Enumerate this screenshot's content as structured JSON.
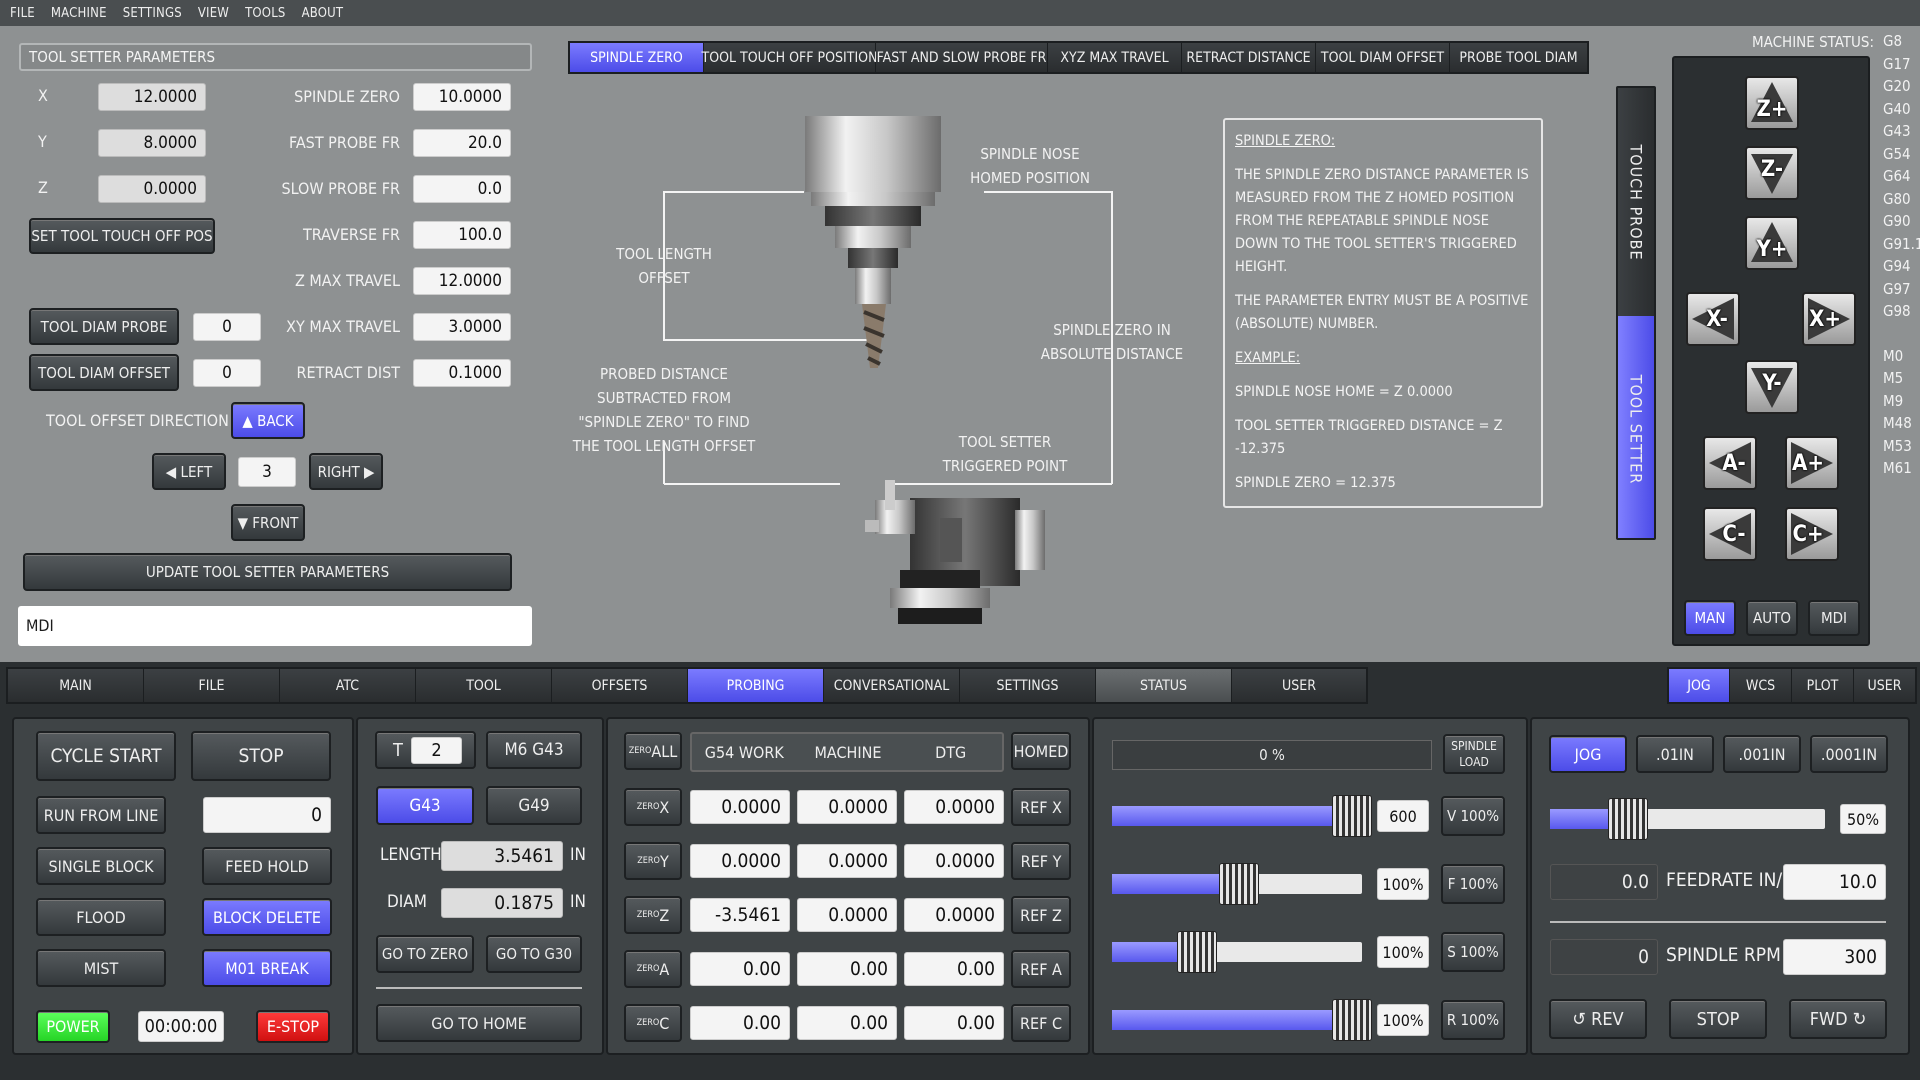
{
  "menu": [
    "FILE",
    "MACHINE",
    "SETTINGS",
    "VIEW",
    "TOOLS",
    "ABOUT"
  ],
  "params": {
    "title": "TOOL SETTER PARAMETERS",
    "x_label": "X",
    "x_val": "12.0000",
    "y_label": "Y",
    "y_val": "8.0000",
    "z_label": "Z",
    "z_val": "0.0000",
    "set_touch": "SET TOOL TOUCH OFF POS",
    "spindle_zero_label": "SPINDLE ZERO",
    "spindle_zero_val": "10.0000",
    "fast_probe_label": "FAST PROBE FR",
    "fast_probe_val": "20.0",
    "slow_probe_label": "SLOW PROBE FR",
    "slow_probe_val": "0.0",
    "traverse_label": "TRAVERSE FR",
    "traverse_val": "100.0",
    "zmax_label": "Z MAX TRAVEL",
    "zmax_val": "12.0000",
    "xymax_label": "XY MAX TRAVEL",
    "xymax_val": "3.0000",
    "retract_label": "RETRACT DIST",
    "retract_val": "0.1000",
    "diam_probe": "TOOL DIAM PROBE",
    "diam_probe_val": "0",
    "diam_offset": "TOOL DIAM OFFSET",
    "diam_offset_val": "0",
    "offset_dir": "TOOL OFFSET DIRECTION",
    "back": "BACK",
    "left": "LEFT",
    "right": "RIGHT",
    "front": "FRONT",
    "dir_val": "3",
    "update": "UPDATE TOOL SETTER PARAMETERS",
    "mdi": "MDI"
  },
  "top_tabs": [
    "SPINDLE ZERO",
    "TOOL TOUCH OFF POSITION",
    "FAST AND SLOW PROBE FR",
    "XYZ MAX TRAVEL",
    "RETRACT DISTANCE",
    "TOOL DIAM OFFSET",
    "PROBE TOOL DIAM"
  ],
  "diagram": {
    "nose": "SPINDLE NOSE\nHOMED POSITION",
    "tlo": "TOOL LENGTH\nOFFSET",
    "szabs": "SPINDLE ZERO IN\nABSOLUTE DISTANCE",
    "probed": "PROBED DISTANCE\nSUBTRACTED FROM\n\"SPINDLE ZERO\" TO FIND\nTHE TOOL LENGTH OFFSET",
    "trig": "TOOL SETTER\nTRIGGERED POINT"
  },
  "info": {
    "h": "SPINDLE ZERO:",
    "p1": "THE SPINDLE ZERO DISTANCE PARAMETER IS MEASURED FROM THE Z HOMED POSITION FROM THE REPEATABLE SPINDLE NOSE DOWN TO THE TOOL SETTER'S TRIGGERED HEIGHT.",
    "p2": "THE PARAMETER ENTRY MUST BE A POSITIVE (ABSOLUTE) NUMBER.",
    "ex": "EXAMPLE:",
    "l1": "SPINDLE NOSE HOME = Z 0.0000",
    "l2": "TOOL SETTER TRIGGERED DISTANCE = Z -12.375",
    "l3": "SPINDLE ZERO = 12.375"
  },
  "side_tabs": {
    "probe": "TOUCH PROBE",
    "setter": "TOOL SETTER"
  },
  "status": {
    "title": "MACHINE STATUS:",
    "codes": [
      "G8",
      "G17",
      "G20",
      "G40",
      "G43",
      "G54",
      "G64",
      "G80",
      "G90",
      "G91.1",
      "G94",
      "G97",
      "G98",
      "",
      "M0",
      "M5",
      "M9",
      "M48",
      "M53",
      "M61"
    ]
  },
  "jog": {
    "zp": "Z+",
    "zm": "Z-",
    "yp": "Y+",
    "xm": "X-",
    "xp": "X+",
    "ym": "Y-",
    "am": "A-",
    "ap": "A+",
    "cm": "C-",
    "cp": "C+",
    "man": "MAN",
    "auto": "AUTO",
    "mdi": "MDI"
  },
  "main_tabs": [
    "MAIN",
    "FILE",
    "ATC",
    "TOOL",
    "OFFSETS",
    "PROBING",
    "CONVERSATIONAL",
    "SETTINGS",
    "STATUS",
    "USER"
  ],
  "right_tabs": [
    "JOG",
    "WCS",
    "PLOT",
    "USER"
  ],
  "ctrl": {
    "cycle": "CYCLE START",
    "stop": "STOP",
    "runfrom": "RUN FROM LINE",
    "runfrom_val": "0",
    "single": "SINGLE BLOCK",
    "hold": "FEED HOLD",
    "flood": "FLOOD",
    "blockdel": "BLOCK DELETE",
    "mist": "MIST",
    "m01": "M01 BREAK",
    "power": "POWER",
    "time": "00:00:00",
    "estop": "E-STOP"
  },
  "tool": {
    "t": "T",
    "t_val": "2",
    "m6": "M6 G43",
    "g43": "G43",
    "g49": "G49",
    "len": "LENGTH",
    "len_val": "3.5461",
    "in1": "IN",
    "diam": "DIAM",
    "diam_val": "0.1875",
    "in2": "IN",
    "gozero": "GO TO ZERO",
    "g30": "GO TO G30",
    "home": "GO TO HOME"
  },
  "dro": {
    "zero_prefix": "ZERO",
    "zero_all": "ALL",
    "headers": [
      "G54 WORK",
      "MACHINE",
      "DTG"
    ],
    "homed": "HOMED",
    "rows": [
      {
        "axis": "X",
        "w": "0.0000",
        "m": "0.0000",
        "d": "0.0000",
        "ref": "REF X"
      },
      {
        "axis": "Y",
        "w": "0.0000",
        "m": "0.0000",
        "d": "0.0000",
        "ref": "REF Y"
      },
      {
        "axis": "Z",
        "w": "-3.5461",
        "m": "0.0000",
        "d": "0.0000",
        "ref": "REF Z"
      },
      {
        "axis": "A",
        "w": "0.00",
        "m": "0.00",
        "d": "0.00",
        "ref": "REF A"
      },
      {
        "axis": "C",
        "w": "0.00",
        "m": "0.00",
        "d": "0.00",
        "ref": "REF C"
      }
    ]
  },
  "ovr": {
    "load": "0 %",
    "load_lbl": "SPINDLE\nLOAD",
    "rows": [
      {
        "val": "600",
        "btn": "V 100%",
        "level": 0.95
      },
      {
        "val": "100%",
        "btn": "F 100%",
        "level": 0.5
      },
      {
        "val": "100%",
        "btn": "S 100%",
        "level": 0.33
      },
      {
        "val": "100%",
        "btn": "R 100%",
        "level": 0.95
      }
    ]
  },
  "jogpanel": {
    "jog": "JOG",
    "i1": ".01IN",
    "i2": ".001IN",
    "i3": ".0001IN",
    "pct": "50%",
    "pct_level": 0.5,
    "feed_cur": "0.0",
    "feed_lbl": "FEEDRATE IN/M",
    "feed_val": "10.0",
    "rpm_cur": "0",
    "rpm_lbl": "SPINDLE RPM",
    "rpm_val": "300",
    "rev": "REV",
    "stop": "STOP",
    "fwd": "FWD"
  },
  "colors": {
    "accent": "#5a5af0",
    "bg": "#8e9192",
    "dark": "#2b2f31"
  }
}
